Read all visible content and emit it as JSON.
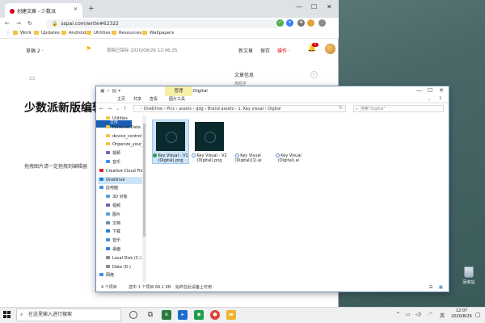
{
  "browser": {
    "tab_title": "创建文章 - 少数派",
    "url": "sspai.com/write#62322",
    "bookmarks": [
      "Work",
      "Updates",
      "Android",
      "Utilities",
      "Resources",
      "Wallpapers"
    ]
  },
  "editor": {
    "draft_label": "草稿 2 ·",
    "saved_status": "草稿已保存 2020/08/26 12:06:25",
    "new_article": "新文章",
    "save": "保存",
    "publish": "操作 ·",
    "notification_count": "4",
    "side_heading": "文章信息",
    "side_sub": "简短字",
    "article_title": "少数派新版编辑器",
    "image_hint": "拖拽图片请一定拖拽到编辑器"
  },
  "explorer": {
    "context_tab": "管理",
    "folder_name": "Digital",
    "ribbon_tabs": [
      "文件",
      "主页",
      "共享",
      "查看",
      "图片工具"
    ],
    "breadcrumb": "›  OneDrive  ›  Pics  ›  assets  ›  gdg  ›  Brand assets  ›  1. Key visual  ›  Digital",
    "search_placeholder": "搜索\"Digital\"",
    "nav_items": [
      {
        "label": "Utilities",
        "icon": "folder"
      },
      {
        "label": "Personal Data",
        "icon": "folder"
      },
      {
        "label": "device_control",
        "icon": "folder"
      },
      {
        "label": "Organize_your_li",
        "icon": "folder"
      },
      {
        "label": "视频",
        "icon": "video"
      },
      {
        "label": "音乐",
        "icon": "music"
      },
      {
        "label": "Creative Cloud File",
        "icon": "cc"
      },
      {
        "label": "OneDrive",
        "icon": "cloud"
      },
      {
        "label": "此电脑",
        "icon": "pc"
      },
      {
        "label": "3D 对象",
        "icon": "3d"
      },
      {
        "label": "视频",
        "icon": "video"
      },
      {
        "label": "图片",
        "icon": "pictures"
      },
      {
        "label": "文档",
        "icon": "docs"
      },
      {
        "label": "下载",
        "icon": "download"
      },
      {
        "label": "音乐",
        "icon": "music"
      },
      {
        "label": "桌面",
        "icon": "desktop"
      },
      {
        "label": "Local Disk (C:)",
        "icon": "disk"
      },
      {
        "label": "Data (D:)",
        "icon": "disk"
      },
      {
        "label": "网络",
        "icon": "network"
      }
    ],
    "files": [
      {
        "name": "Key Visual - V1 (Digital).png",
        "kind": "image",
        "synced": true,
        "selected": true
      },
      {
        "name": "Key Visual - V2 (Digital).png",
        "kind": "image",
        "synced": false,
        "selected": false
      },
      {
        "name": "Key Visual (Digital)(1).ai",
        "kind": "ai",
        "synced": false,
        "selected": false
      },
      {
        "name": "Key Visual (Digital).ai",
        "kind": "ai",
        "synced": false,
        "selected": false
      }
    ],
    "status_count": "4 个项目",
    "status_selected": "选中 1 个项目  66.1 KB",
    "status_sync": "始终在此设备上可用"
  },
  "desktop": {
    "recycle_bin": "回收站"
  },
  "taskbar": {
    "search_placeholder": "在这里输入进行搜索",
    "input_method": "英",
    "time": "12:07",
    "date": "2020/8/26"
  }
}
